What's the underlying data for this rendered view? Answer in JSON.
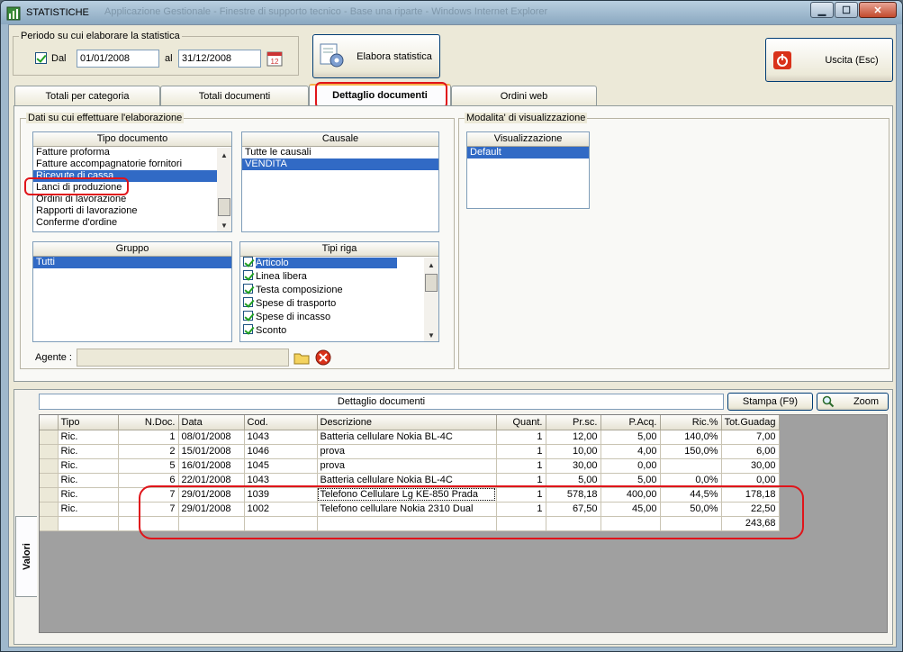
{
  "window": {
    "title": "STATISTICHE",
    "background_title": "Applicazione Gestionale - Finestre di supporto tecnico - Base una riparte - Windows Internet Explorer",
    "buttons": {
      "minimize": "0",
      "maximize": "1",
      "close": "r"
    }
  },
  "period": {
    "legend": "Periodo su cui elaborare la statistica",
    "from_label": "Dal",
    "from_value": "01/01/2008",
    "to_label": "al",
    "to_value": "31/12/2008",
    "checked": true
  },
  "elabora_label": "Elabora statistica",
  "exit_label": "Uscita (Esc)",
  "tabs": [
    {
      "label": "Totali per categoria"
    },
    {
      "label": "Totali documenti"
    },
    {
      "label": "Dettaglio documenti",
      "active": true
    },
    {
      "label": "Ordini web"
    }
  ],
  "filters": {
    "legend": "Dati su cui effettuare l'elaborazione",
    "tipo_documento": {
      "header": "Tipo documento",
      "items": [
        "Fatture proforma",
        "Fatture accompagnatorie fornitori",
        "Ricevute di cassa",
        "Lanci di produzione",
        "Ordini di lavorazione",
        "Rapporti di lavorazione",
        "Conferme d'ordine"
      ],
      "selected_index": 2
    },
    "causale": {
      "header": "Causale",
      "items": [
        "Tutte le causali",
        "VENDITA"
      ],
      "selected_index": 1
    },
    "gruppo": {
      "header": "Gruppo",
      "items": [
        "Tutti"
      ],
      "selected_index": 0
    },
    "tipi_riga": {
      "header": "Tipi riga",
      "items": [
        "Articolo",
        "Linea libera",
        "Testa composizione",
        "Spese di trasporto",
        "Spese di incasso",
        "Sconto"
      ],
      "selected_index": 0
    },
    "agente_label": "Agente :",
    "agente_value": ""
  },
  "modalita": {
    "legend": "Modalita' di visualizzazione",
    "header": "Visualizzazione",
    "items": [
      "Default"
    ],
    "selected_index": 0
  },
  "results": {
    "caption": "Dettaglio documenti",
    "stampa_label": "Stampa (F9)",
    "zoom_label": "Zoom",
    "side_tab": "Valori",
    "columns": [
      "Tipo",
      "N.Doc.",
      "Data",
      "Cod.",
      "Descrizione",
      "Quant.",
      "Pr.sc.",
      "P.Acq.",
      "Ric.%",
      "Tot.Guadag"
    ],
    "rows": [
      [
        "Ric.",
        "1",
        "08/01/2008",
        "1043",
        "Batteria cellulare Nokia BL-4C",
        "1",
        "12,00",
        "5,00",
        "140,0%",
        "7,00"
      ],
      [
        "Ric.",
        "2",
        "15/01/2008",
        "1046",
        "prova",
        "1",
        "10,00",
        "4,00",
        "150,0%",
        "6,00"
      ],
      [
        "Ric.",
        "5",
        "16/01/2008",
        "1045",
        "prova",
        "1",
        "30,00",
        "0,00",
        "",
        "30,00"
      ],
      [
        "Ric.",
        "6",
        "22/01/2008",
        "1043",
        "Batteria cellulare Nokia BL-4C",
        "1",
        "5,00",
        "5,00",
        "0,0%",
        "0,00"
      ],
      [
        "Ric.",
        "7",
        "29/01/2008",
        "1039",
        "Telefono Cellulare Lg KE-850 Prada",
        "1",
        "578,18",
        "400,00",
        "44,5%",
        "178,18"
      ],
      [
        "Ric.",
        "7",
        "29/01/2008",
        "1002",
        "Telefono cellulare Nokia 2310 Dual",
        "1",
        "67,50",
        "45,00",
        "50,0%",
        "22,50"
      ]
    ],
    "total": "243,68"
  },
  "colors": {
    "highlight": "#e0141a",
    "selection": "#316ac5",
    "grid_empty": "#a0a0a0"
  }
}
